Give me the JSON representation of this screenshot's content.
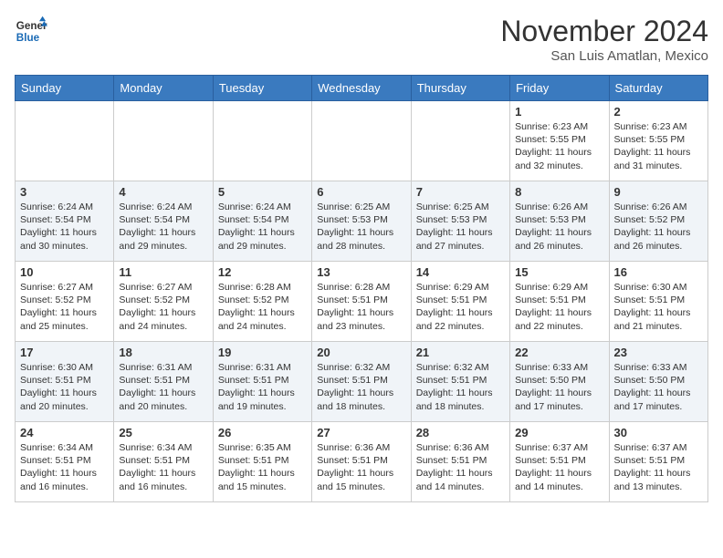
{
  "header": {
    "logo_line1": "General",
    "logo_line2": "Blue",
    "month": "November 2024",
    "location": "San Luis Amatlan, Mexico"
  },
  "weekdays": [
    "Sunday",
    "Monday",
    "Tuesday",
    "Wednesday",
    "Thursday",
    "Friday",
    "Saturday"
  ],
  "weeks": [
    [
      {
        "day": "",
        "info": ""
      },
      {
        "day": "",
        "info": ""
      },
      {
        "day": "",
        "info": ""
      },
      {
        "day": "",
        "info": ""
      },
      {
        "day": "",
        "info": ""
      },
      {
        "day": "1",
        "info": "Sunrise: 6:23 AM\nSunset: 5:55 PM\nDaylight: 11 hours\nand 32 minutes."
      },
      {
        "day": "2",
        "info": "Sunrise: 6:23 AM\nSunset: 5:55 PM\nDaylight: 11 hours\nand 31 minutes."
      }
    ],
    [
      {
        "day": "3",
        "info": "Sunrise: 6:24 AM\nSunset: 5:54 PM\nDaylight: 11 hours\nand 30 minutes."
      },
      {
        "day": "4",
        "info": "Sunrise: 6:24 AM\nSunset: 5:54 PM\nDaylight: 11 hours\nand 29 minutes."
      },
      {
        "day": "5",
        "info": "Sunrise: 6:24 AM\nSunset: 5:54 PM\nDaylight: 11 hours\nand 29 minutes."
      },
      {
        "day": "6",
        "info": "Sunrise: 6:25 AM\nSunset: 5:53 PM\nDaylight: 11 hours\nand 28 minutes."
      },
      {
        "day": "7",
        "info": "Sunrise: 6:25 AM\nSunset: 5:53 PM\nDaylight: 11 hours\nand 27 minutes."
      },
      {
        "day": "8",
        "info": "Sunrise: 6:26 AM\nSunset: 5:53 PM\nDaylight: 11 hours\nand 26 minutes."
      },
      {
        "day": "9",
        "info": "Sunrise: 6:26 AM\nSunset: 5:52 PM\nDaylight: 11 hours\nand 26 minutes."
      }
    ],
    [
      {
        "day": "10",
        "info": "Sunrise: 6:27 AM\nSunset: 5:52 PM\nDaylight: 11 hours\nand 25 minutes."
      },
      {
        "day": "11",
        "info": "Sunrise: 6:27 AM\nSunset: 5:52 PM\nDaylight: 11 hours\nand 24 minutes."
      },
      {
        "day": "12",
        "info": "Sunrise: 6:28 AM\nSunset: 5:52 PM\nDaylight: 11 hours\nand 24 minutes."
      },
      {
        "day": "13",
        "info": "Sunrise: 6:28 AM\nSunset: 5:51 PM\nDaylight: 11 hours\nand 23 minutes."
      },
      {
        "day": "14",
        "info": "Sunrise: 6:29 AM\nSunset: 5:51 PM\nDaylight: 11 hours\nand 22 minutes."
      },
      {
        "day": "15",
        "info": "Sunrise: 6:29 AM\nSunset: 5:51 PM\nDaylight: 11 hours\nand 22 minutes."
      },
      {
        "day": "16",
        "info": "Sunrise: 6:30 AM\nSunset: 5:51 PM\nDaylight: 11 hours\nand 21 minutes."
      }
    ],
    [
      {
        "day": "17",
        "info": "Sunrise: 6:30 AM\nSunset: 5:51 PM\nDaylight: 11 hours\nand 20 minutes."
      },
      {
        "day": "18",
        "info": "Sunrise: 6:31 AM\nSunset: 5:51 PM\nDaylight: 11 hours\nand 20 minutes."
      },
      {
        "day": "19",
        "info": "Sunrise: 6:31 AM\nSunset: 5:51 PM\nDaylight: 11 hours\nand 19 minutes."
      },
      {
        "day": "20",
        "info": "Sunrise: 6:32 AM\nSunset: 5:51 PM\nDaylight: 11 hours\nand 18 minutes."
      },
      {
        "day": "21",
        "info": "Sunrise: 6:32 AM\nSunset: 5:51 PM\nDaylight: 11 hours\nand 18 minutes."
      },
      {
        "day": "22",
        "info": "Sunrise: 6:33 AM\nSunset: 5:50 PM\nDaylight: 11 hours\nand 17 minutes."
      },
      {
        "day": "23",
        "info": "Sunrise: 6:33 AM\nSunset: 5:50 PM\nDaylight: 11 hours\nand 17 minutes."
      }
    ],
    [
      {
        "day": "24",
        "info": "Sunrise: 6:34 AM\nSunset: 5:51 PM\nDaylight: 11 hours\nand 16 minutes."
      },
      {
        "day": "25",
        "info": "Sunrise: 6:34 AM\nSunset: 5:51 PM\nDaylight: 11 hours\nand 16 minutes."
      },
      {
        "day": "26",
        "info": "Sunrise: 6:35 AM\nSunset: 5:51 PM\nDaylight: 11 hours\nand 15 minutes."
      },
      {
        "day": "27",
        "info": "Sunrise: 6:36 AM\nSunset: 5:51 PM\nDaylight: 11 hours\nand 15 minutes."
      },
      {
        "day": "28",
        "info": "Sunrise: 6:36 AM\nSunset: 5:51 PM\nDaylight: 11 hours\nand 14 minutes."
      },
      {
        "day": "29",
        "info": "Sunrise: 6:37 AM\nSunset: 5:51 PM\nDaylight: 11 hours\nand 14 minutes."
      },
      {
        "day": "30",
        "info": "Sunrise: 6:37 AM\nSunset: 5:51 PM\nDaylight: 11 hours\nand 13 minutes."
      }
    ]
  ]
}
